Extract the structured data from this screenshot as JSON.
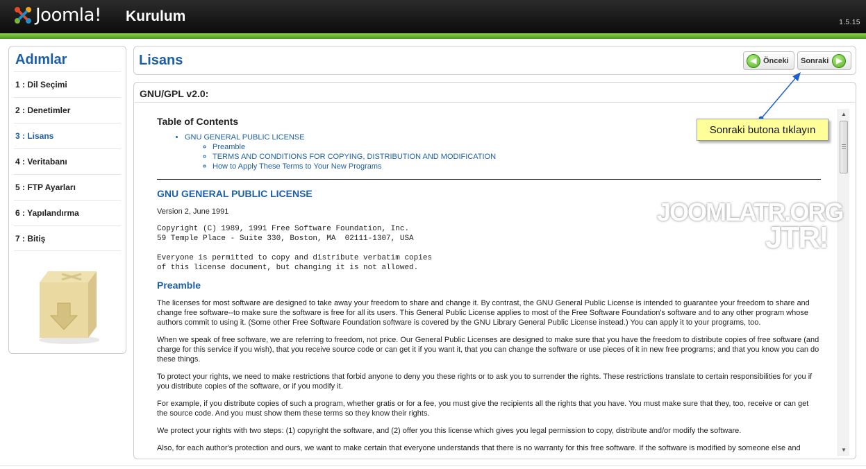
{
  "header": {
    "logo_text": "Joomla!",
    "title": "Kurulum",
    "version": "1.5.15"
  },
  "sidebar": {
    "heading": "Adımlar",
    "steps": [
      {
        "label": "1 : Dil Seçimi",
        "active": false
      },
      {
        "label": "2 : Denetimler",
        "active": false
      },
      {
        "label": "3 : Lisans",
        "active": true
      },
      {
        "label": "4 : Veritabanı",
        "active": false
      },
      {
        "label": "5 : FTP Ayarları",
        "active": false
      },
      {
        "label": "6 : Yapılandırma",
        "active": false
      },
      {
        "label": "7 : Bitiş",
        "active": false
      }
    ]
  },
  "titlebar": {
    "title": "Lisans",
    "prev_label": "Önceki",
    "next_label": "Sonraki"
  },
  "panel": {
    "title": "GNU/GPL v2.0:"
  },
  "license": {
    "toc_heading": "Table of Contents",
    "toc_main": "GNU GENERAL PUBLIC LICENSE",
    "toc_sub": [
      "Preamble",
      "TERMS AND CONDITIONS FOR COPYING, DISTRIBUTION AND MODIFICATION",
      "How to Apply These Terms to Your New Programs"
    ],
    "heading": "GNU GENERAL PUBLIC LICENSE",
    "version_line": "Version 2, June 1991",
    "copyright_1": "Copyright (C) 1989, 1991 Free Software Foundation, Inc.",
    "copyright_2": "59 Temple Place - Suite 330, Boston, MA  02111-1307, USA",
    "everyone_1": "Everyone is permitted to copy and distribute verbatim copies",
    "everyone_2": "of this license document, but changing it is not allowed.",
    "preamble_heading": "Preamble",
    "paragraphs": [
      "The licenses for most software are designed to take away your freedom to share and change it. By contrast, the GNU General Public License is intended to guarantee your freedom to share and change free software--to make sure the software is free for all its users. This General Public License applies to most of the Free Software Foundation's software and to any other program whose authors commit to using it. (Some other Free Software Foundation software is covered by the GNU Library General Public License instead.) You can apply it to your programs, too.",
      "When we speak of free software, we are referring to freedom, not price. Our General Public Licenses are designed to make sure that you have the freedom to distribute copies of free software (and charge for this service if you wish), that you receive source code or can get it if you want it, that you can change the software or use pieces of it in new free programs; and that you know you can do these things.",
      "To protect your rights, we need to make restrictions that forbid anyone to deny you these rights or to ask you to surrender the rights. These restrictions translate to certain responsibilities for you if you distribute copies of the software, or if you modify it.",
      "For example, if you distribute copies of such a program, whether gratis or for a fee, you must give the recipients all the rights that you have. You must make sure that they, too, receive or can get the source code. And you must show them these terms so they know their rights.",
      "We protect your rights with two steps: (1) copyright the software, and (2) offer you this license which gives you legal permission to copy, distribute and/or modify the software.",
      "Also, for each author's protection and ours, we want to make certain that everyone understands that there is no warranty for this free software. If the software is modified by someone else and"
    ]
  },
  "watermark": {
    "line1": "JOOMLATR.ORG",
    "line2": "JTR!"
  },
  "callout": {
    "text": "Sonraki butona tıklayın"
  },
  "colors": {
    "accent_blue": "#1b5fa8",
    "header_bg": "#111111",
    "header_stripe": "#6dbb2e",
    "callout_bg": "#ffff99"
  }
}
